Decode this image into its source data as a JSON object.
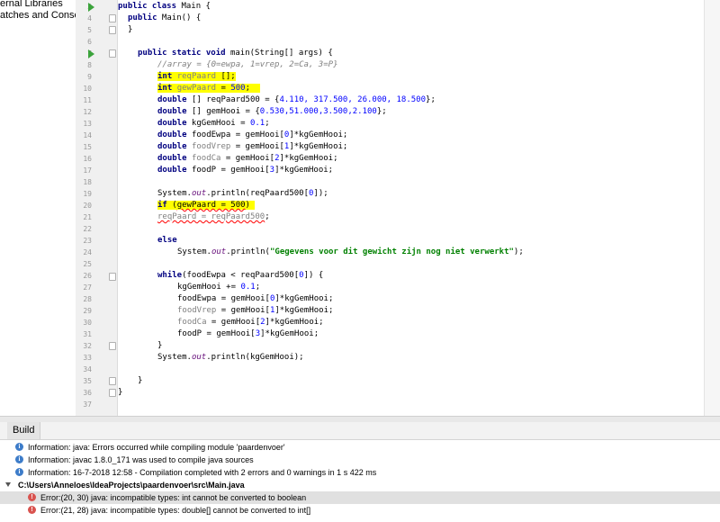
{
  "project_tree": {
    "items": [
      {
        "label": "ernal Libraries"
      },
      {
        "label": "atches and Consoles"
      }
    ]
  },
  "editor": {
    "lines": [
      {
        "num": "3"
      },
      {
        "num": "4"
      },
      {
        "num": "5"
      },
      {
        "num": "6"
      },
      {
        "num": "7"
      },
      {
        "num": "8"
      },
      {
        "num": "9"
      },
      {
        "num": "10"
      },
      {
        "num": "11"
      },
      {
        "num": "12"
      },
      {
        "num": "13"
      },
      {
        "num": "14"
      },
      {
        "num": "15"
      },
      {
        "num": "16"
      },
      {
        "num": "17"
      },
      {
        "num": "18"
      },
      {
        "num": "19"
      },
      {
        "num": "20"
      },
      {
        "num": "21"
      },
      {
        "num": "22"
      },
      {
        "num": "23"
      },
      {
        "num": "24"
      },
      {
        "num": "25"
      },
      {
        "num": "26"
      },
      {
        "num": "27"
      },
      {
        "num": "28"
      },
      {
        "num": "29"
      },
      {
        "num": "30"
      },
      {
        "num": "31"
      },
      {
        "num": "32"
      },
      {
        "num": "33"
      },
      {
        "num": "34"
      },
      {
        "num": "35"
      },
      {
        "num": "36"
      },
      {
        "num": "37"
      }
    ],
    "code": {
      "l3_kw": "public class",
      "l3_rest": " Main {",
      "l4_kw": "public",
      "l4_rest": " Main() {",
      "l5": "}",
      "l7_kw": "public static void",
      "l7_rest": " main(String[] args) {",
      "l8": "//array = {0=ewpa, 1=vrep, 2=Ca, 3=P}",
      "l9_kw": "int",
      "l9_var": "reqPaard",
      "l9_rest": " [];",
      "l10_kw": "int",
      "l10_var": "gewPaard",
      "l10_rest": " = ",
      "l10_num": "500",
      "l10_end": ";",
      "l11_kw": "double",
      "l11_rest": " [] reqPaard500 = {",
      "l11_vals": "4.110, 317.500, 26.000, 18.500",
      "l11_end": "};",
      "l12_kw": "double",
      "l12_rest": " [] gemHooi = {",
      "l12_vals": "0.530,51.000,3.500,2.100",
      "l12_end": "};",
      "l13_kw": "double",
      "l13_rest": " kgGemHooi = ",
      "l13_num": "0.1",
      "l13_end": ";",
      "l14_kw": "double",
      "l14_var": "foodEwpa",
      "l14_a": " = gemHooi[",
      "l14_i": "0",
      "l14_b": "]*kgGemHooi;",
      "l15_kw": "double",
      "l15_var": "foodVrep",
      "l15_a": " = gemHooi[",
      "l15_i": "1",
      "l15_b": "]*kgGemHooi;",
      "l16_kw": "double",
      "l16_var": "foodCa",
      "l16_a": " = gemHooi[",
      "l16_i": "2",
      "l16_b": "]*kgGemHooi;",
      "l17_kw": "double",
      "l17_var": "foodP",
      "l17_a": " = gemHooi[",
      "l17_i": "3",
      "l17_b": "]*kgGemHooi;",
      "l19_a": "System.",
      "l19_fld": "out",
      "l19_b": ".println(reqPaard500[",
      "l19_i": "0",
      "l19_c": "]);",
      "l20_kw": "if",
      "l20_a": " (",
      "l20_err": "gewPaard = 500",
      "l20_b": ")",
      "l21_err": "reqPaard = reqPaard500",
      "l21_end": ";",
      "l23_kw": "else",
      "l24_a": "System.",
      "l24_fld": "out",
      "l24_b": ".println(",
      "l24_str": "\"Gegevens voor dit gewicht zijn nog niet verwerkt\"",
      "l24_c": ");",
      "l26_kw": "while",
      "l26_rest": "(foodEwpa < reqPaard500[",
      "l26_i": "0",
      "l26_end": "]) {",
      "l27_a": "kgGemHooi += ",
      "l27_num": "0.1",
      "l27_end": ";",
      "l28_a": "foodEwpa = gemHooi[",
      "l28_i": "0",
      "l28_b": "]*kgGemHooi;",
      "l29_var": "foodVrep",
      "l29_a": " = gemHooi[",
      "l29_i": "1",
      "l29_b": "]*kgGemHooi;",
      "l30_var": "foodCa",
      "l30_a": " = gemHooi[",
      "l30_i": "2",
      "l30_b": "]*kgGemHooi;",
      "l31_a": "foodP = gemHooi[",
      "l31_i": "3",
      "l31_b": "]*kgGemHooi;",
      "l32": "}",
      "l33_a": "System.",
      "l33_fld": "out",
      "l33_b": ".println(kgGemHooi);",
      "l35": "}",
      "l36": "}"
    }
  },
  "build": {
    "tab_label": "Build",
    "messages": [
      {
        "text": "Information: java: Errors occurred while compiling module 'paardenvoer'"
      },
      {
        "text": "Information: javac 1.8.0_171 was used to compile java sources"
      },
      {
        "text": "Information: 16-7-2018 12:58 - Compilation completed with 2 errors and 0 warnings in 1 s 422 ms"
      },
      {
        "text": "C:\\Users\\Anneloes\\IdeaProjects\\paardenvoer\\src\\Main.java"
      },
      {
        "text": "Error:(20, 30)  java: incompatible types: int cannot be converted to boolean"
      },
      {
        "text": "Error:(21, 28)  java: incompatible types: double[] cannot be converted to int[]"
      }
    ]
  },
  "colors": {
    "keyword": "#000080",
    "string": "#008000",
    "number": "#0000ff",
    "highlight": "#ffff00",
    "error": "#d9534f",
    "info": "#3d7cc9"
  }
}
